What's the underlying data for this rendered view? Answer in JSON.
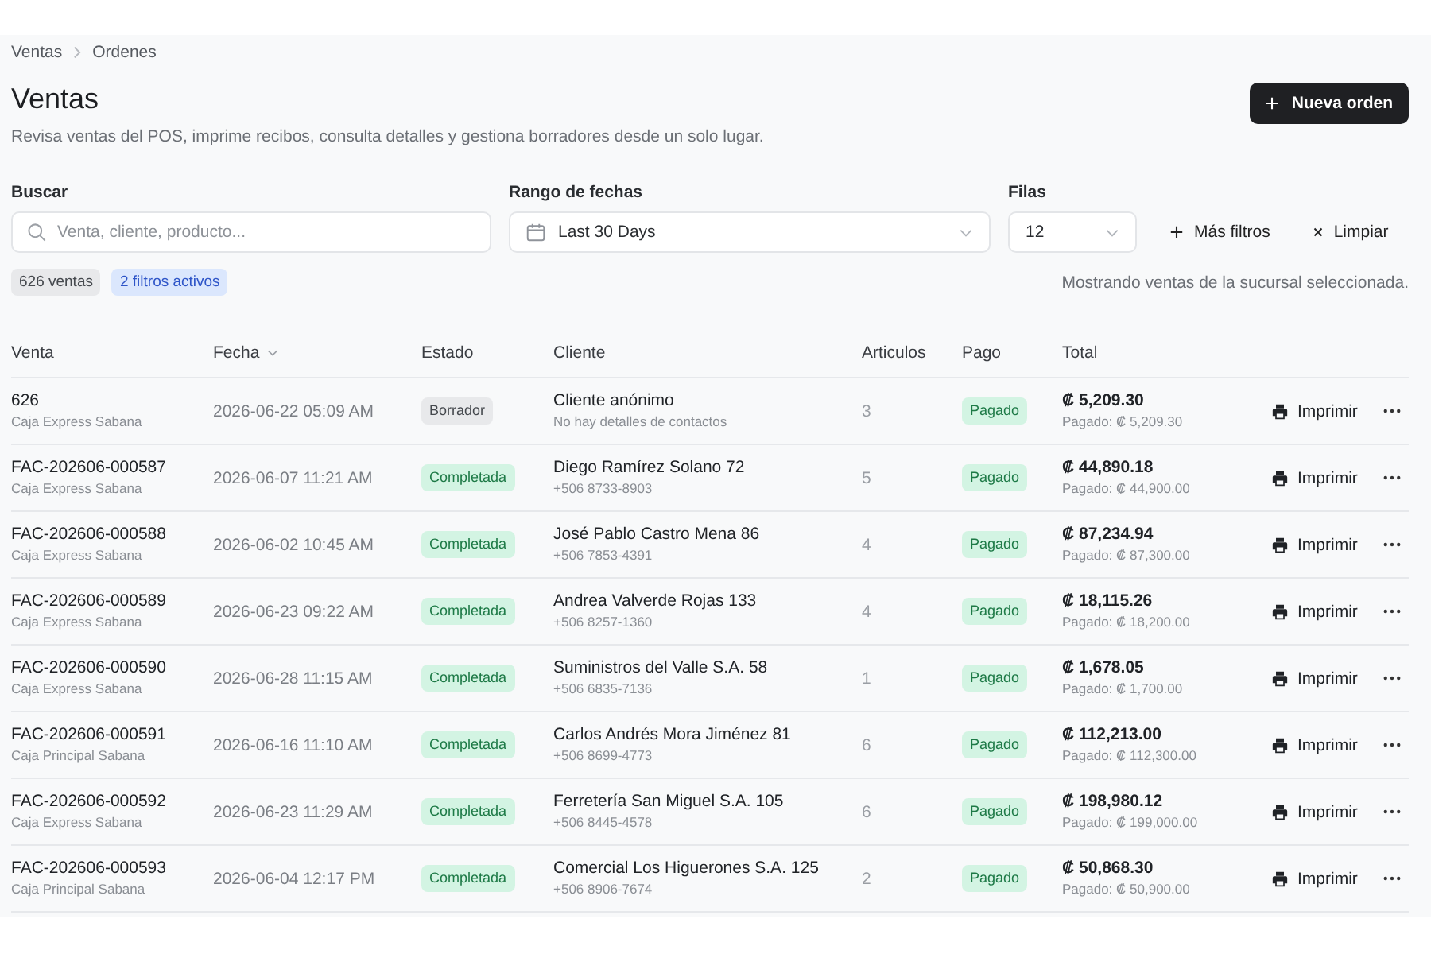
{
  "breadcrumb": [
    {
      "label": "Ventas"
    },
    {
      "label": "Ordenes"
    }
  ],
  "header": {
    "title": "Ventas",
    "description": "Revisa ventas del POS, imprime recibos, consulta detalles y gestiona borradores desde un solo lugar.",
    "primary_button": "Nueva orden"
  },
  "filters": {
    "search": {
      "label": "Buscar",
      "placeholder": "Venta, cliente, producto..."
    },
    "date_range": {
      "label": "Rango de fechas",
      "value": "Last 30 Days"
    },
    "rows_per_page": {
      "label": "Filas",
      "value": "12"
    },
    "more_filters": "Más filtros",
    "clear": "Limpiar"
  },
  "summary": {
    "chips": [
      {
        "label": "626 ventas",
        "kind": "neutral"
      },
      {
        "label": "2 filtros activos",
        "kind": "info"
      }
    ],
    "note": "Mostrando ventas de la sucursal seleccionada."
  },
  "table": {
    "columns": [
      {
        "label": "Venta",
        "sorted": false
      },
      {
        "label": "Fecha",
        "sorted": true
      },
      {
        "label": "Estado",
        "sorted": false
      },
      {
        "label": "Cliente",
        "sorted": false
      },
      {
        "label": "Articulos",
        "sorted": false
      },
      {
        "label": "Pago",
        "sorted": false
      },
      {
        "label": "Total",
        "sorted": false
      }
    ],
    "rows": [
      {
        "sale": "626",
        "register": "Caja Express Sabana",
        "date": "2026-06-22 05:09 AM",
        "status": {
          "label": "Borrador",
          "kind": "neutral"
        },
        "client": "Cliente anónimo",
        "contact": "No hay detalles de contactos",
        "items": "3",
        "payment": {
          "label": "Pagado",
          "kind": "success"
        },
        "total": "₡ 5,209.30",
        "paid": "Pagado: ₡ 5,209.30",
        "print": "Imprimir"
      },
      {
        "sale": "FAC-202606-000587",
        "register": "Caja Express Sabana",
        "date": "2026-06-07 11:21 AM",
        "status": {
          "label": "Completada",
          "kind": "success"
        },
        "client": "Diego Ramírez Solano 72",
        "contact": "+506 8733-8903",
        "items": "5",
        "payment": {
          "label": "Pagado",
          "kind": "success"
        },
        "total": "₡ 44,890.18",
        "paid": "Pagado: ₡ 44,900.00",
        "print": "Imprimir"
      },
      {
        "sale": "FAC-202606-000588",
        "register": "Caja Express Sabana",
        "date": "2026-06-02 10:45 AM",
        "status": {
          "label": "Completada",
          "kind": "success"
        },
        "client": "José Pablo Castro Mena 86",
        "contact": "+506 7853-4391",
        "items": "4",
        "payment": {
          "label": "Pagado",
          "kind": "success"
        },
        "total": "₡ 87,234.94",
        "paid": "Pagado: ₡ 87,300.00",
        "print": "Imprimir"
      },
      {
        "sale": "FAC-202606-000589",
        "register": "Caja Express Sabana",
        "date": "2026-06-23 09:22 AM",
        "status": {
          "label": "Completada",
          "kind": "success"
        },
        "client": "Andrea Valverde Rojas 133",
        "contact": "+506 8257-1360",
        "items": "4",
        "payment": {
          "label": "Pagado",
          "kind": "success"
        },
        "total": "₡ 18,115.26",
        "paid": "Pagado: ₡ 18,200.00",
        "print": "Imprimir"
      },
      {
        "sale": "FAC-202606-000590",
        "register": "Caja Express Sabana",
        "date": "2026-06-28 11:15 AM",
        "status": {
          "label": "Completada",
          "kind": "success"
        },
        "client": "Suministros del Valle S.A. 58",
        "contact": "+506 6835-7136",
        "items": "1",
        "payment": {
          "label": "Pagado",
          "kind": "success"
        },
        "total": "₡ 1,678.05",
        "paid": "Pagado: ₡ 1,700.00",
        "print": "Imprimir"
      },
      {
        "sale": "FAC-202606-000591",
        "register": "Caja Principal Sabana",
        "date": "2026-06-16 11:10 AM",
        "status": {
          "label": "Completada",
          "kind": "success"
        },
        "client": "Carlos Andrés Mora Jiménez 81",
        "contact": "+506 8699-4773",
        "items": "6",
        "payment": {
          "label": "Pagado",
          "kind": "success"
        },
        "total": "₡ 112,213.00",
        "paid": "Pagado: ₡ 112,300.00",
        "print": "Imprimir"
      },
      {
        "sale": "FAC-202606-000592",
        "register": "Caja Express Sabana",
        "date": "2026-06-23 11:29 AM",
        "status": {
          "label": "Completada",
          "kind": "success"
        },
        "client": "Ferretería San Miguel S.A. 105",
        "contact": "+506 8445-4578",
        "items": "6",
        "payment": {
          "label": "Pagado",
          "kind": "success"
        },
        "total": "₡ 198,980.12",
        "paid": "Pagado: ₡ 199,000.00",
        "print": "Imprimir"
      },
      {
        "sale": "FAC-202606-000593",
        "register": "Caja Principal Sabana",
        "date": "2026-06-04 12:17 PM",
        "status": {
          "label": "Completada",
          "kind": "success"
        },
        "client": "Comercial Los Higuerones S.A. 125",
        "contact": "+506 8906-7674",
        "items": "2",
        "payment": {
          "label": "Pagado",
          "kind": "success"
        },
        "total": "₡ 50,868.30",
        "paid": "Pagado: ₡ 50,900.00",
        "print": "Imprimir"
      }
    ]
  }
}
